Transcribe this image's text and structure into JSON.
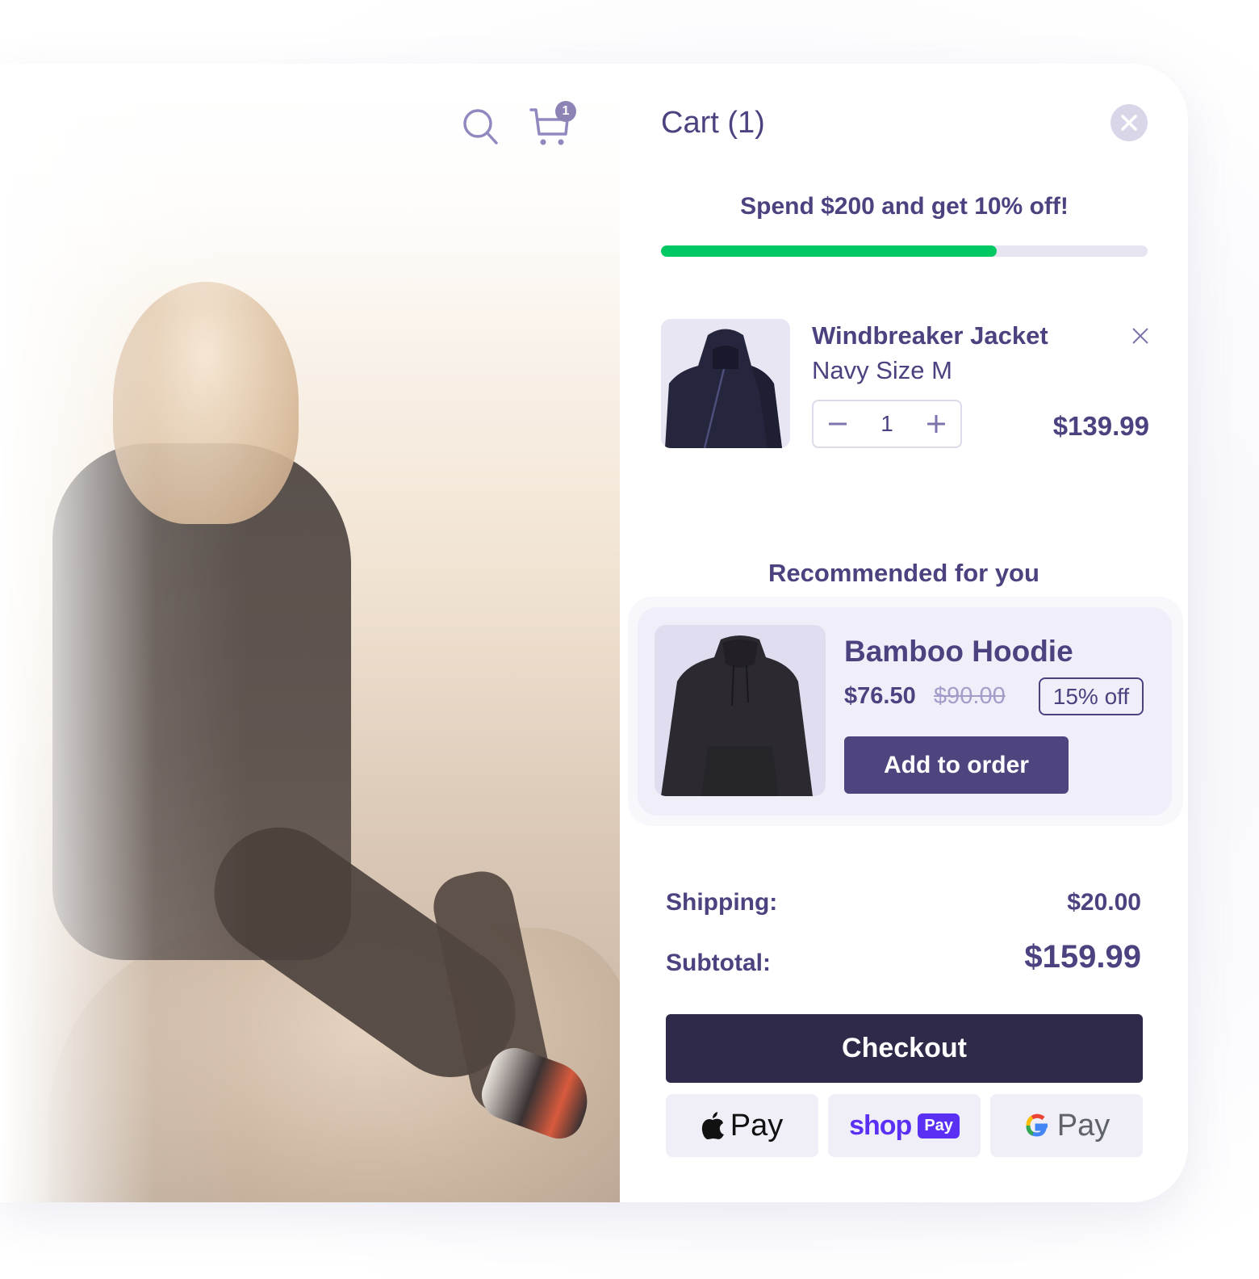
{
  "header": {
    "search_icon": "search-icon",
    "cart_icon": "cart-icon",
    "cart_badge": "1"
  },
  "cart": {
    "title": "Cart (1)",
    "close_icon": "close-icon",
    "promo": {
      "message": "Spend $200 and get 10% off!",
      "progress_percent": 69,
      "progress_color": "#00c964"
    },
    "items": [
      {
        "name": "Windbreaker Jacket",
        "variant": "Navy Size M",
        "quantity": "1",
        "price": "$139.99",
        "image": "navy-windbreaker-jacket"
      }
    ]
  },
  "recommended": {
    "title": "Recommended for you",
    "product": {
      "name": "Bamboo Hoodie",
      "price": "$76.50",
      "original_price": "$90.00",
      "discount_badge": "15% off",
      "add_button": "Add to order",
      "image": "black-hoodie"
    }
  },
  "summary": {
    "shipping_label": "Shipping:",
    "shipping_value": "$20.00",
    "subtotal_label": "Subtotal:",
    "subtotal_value": "$159.99"
  },
  "checkout": {
    "label": "Checkout",
    "payment_methods": [
      {
        "name": "Apple Pay",
        "text": "Pay"
      },
      {
        "name": "Shop Pay",
        "text": "shop",
        "badge": "Pay"
      },
      {
        "name": "Google Pay",
        "text": "Pay"
      }
    ]
  },
  "colors": {
    "primary_text": "#4b4280",
    "add_button": "#4f457e",
    "checkout_button": "#302a4a",
    "shop_pay": "#5a31f4"
  }
}
